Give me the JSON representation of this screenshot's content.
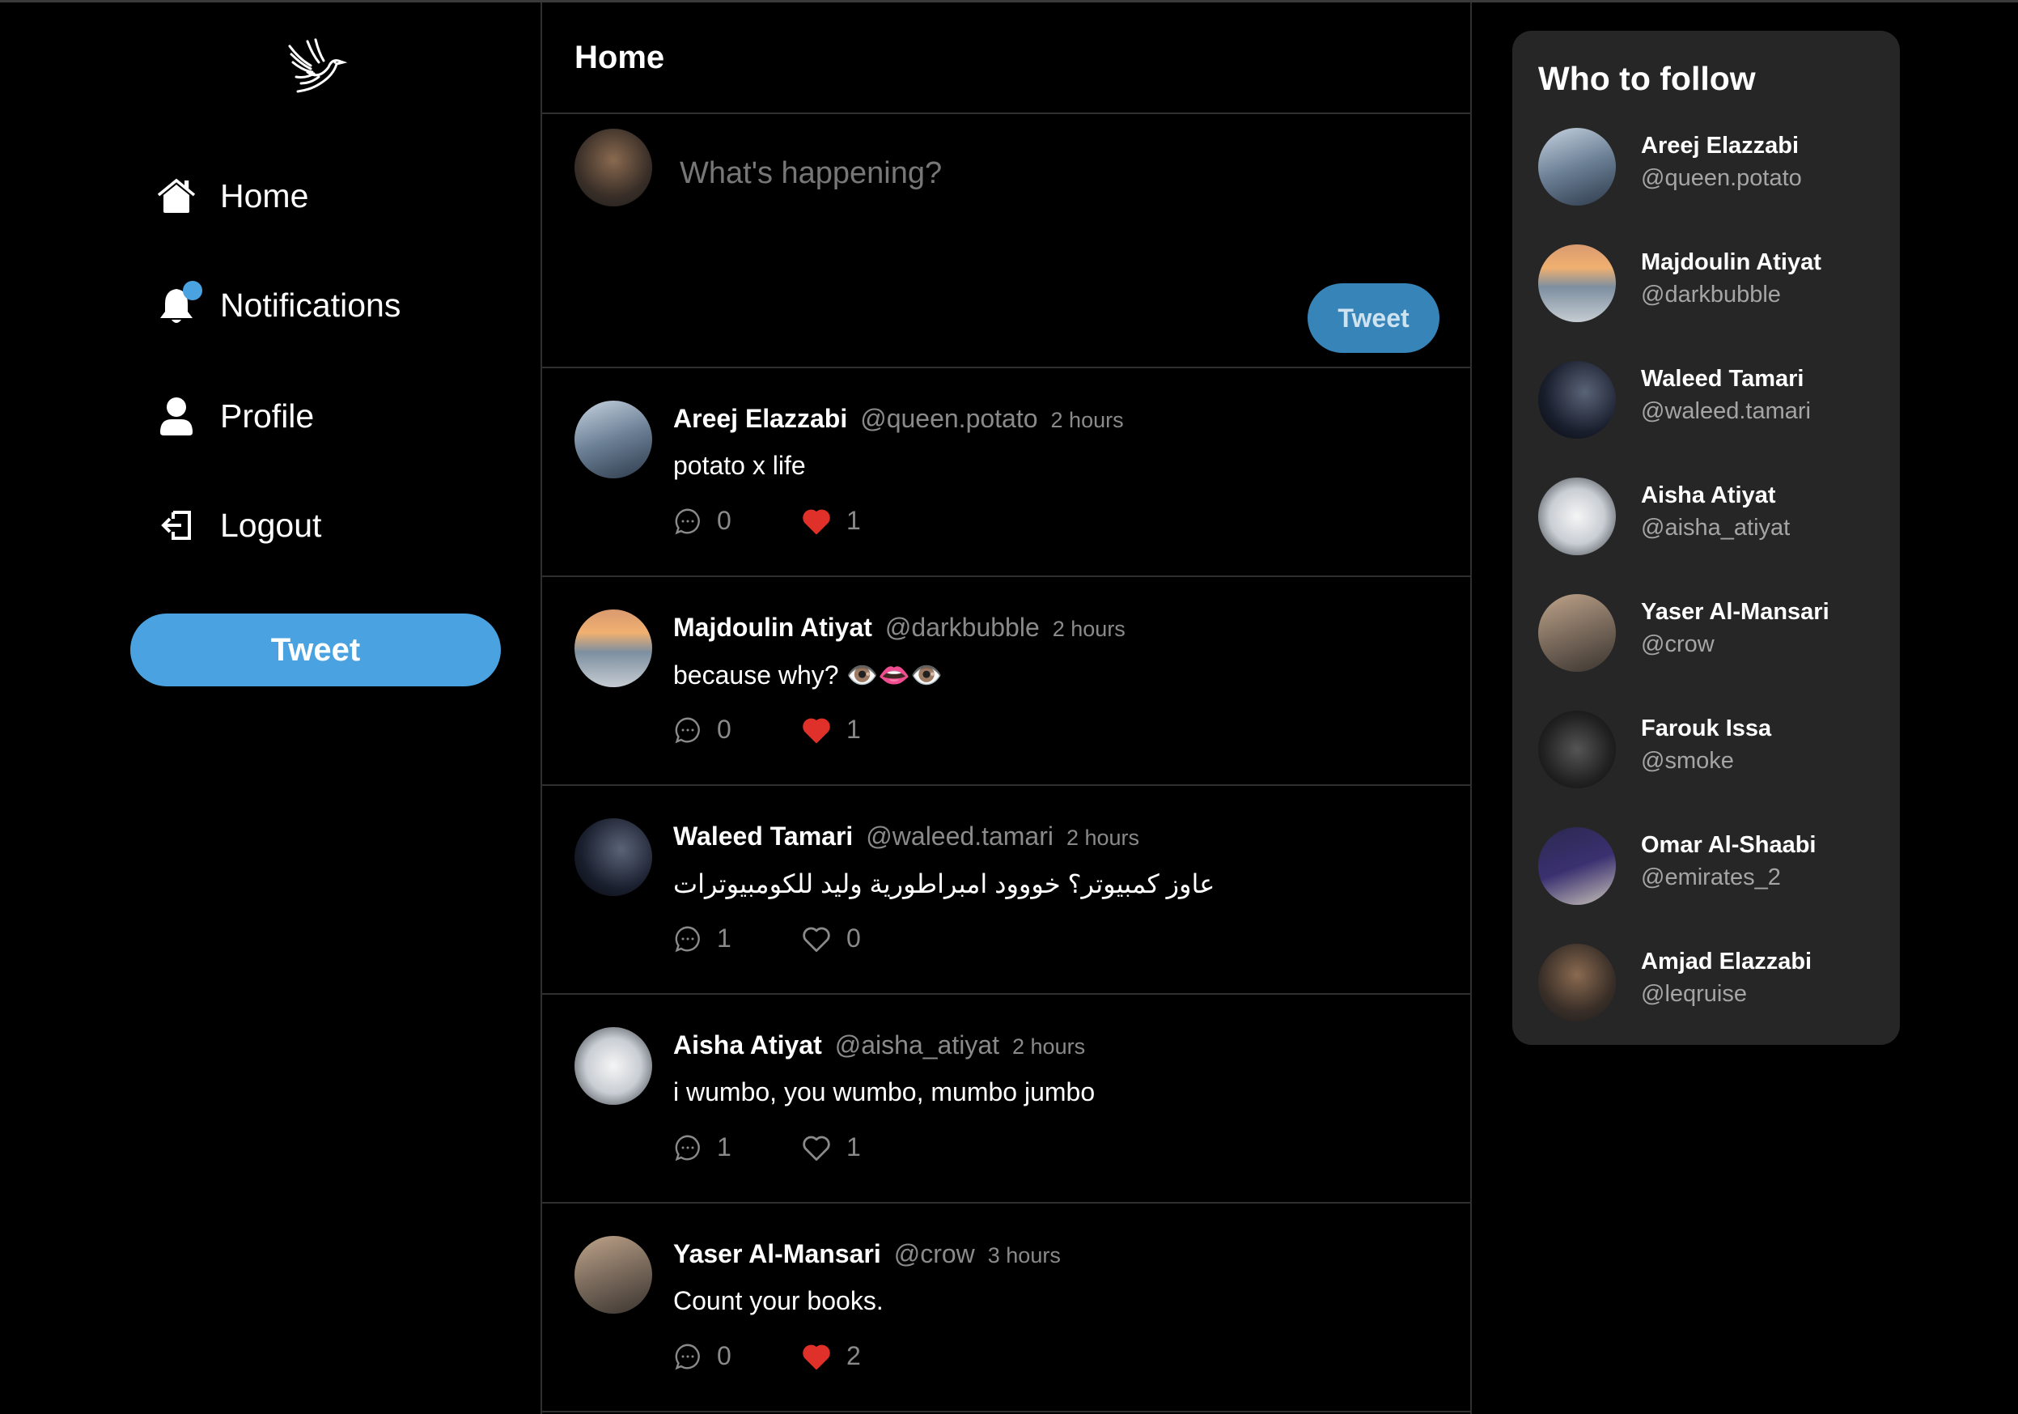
{
  "sidebar": {
    "logo": "bird-logo",
    "nav": [
      {
        "label": "Home",
        "icon": "home-icon"
      },
      {
        "label": "Notifications",
        "icon": "bell-icon"
      },
      {
        "label": "Profile",
        "icon": "user-icon"
      },
      {
        "label": "Logout",
        "icon": "logout-icon"
      }
    ],
    "tweet_label": "Tweet"
  },
  "main": {
    "title": "Home",
    "compose": {
      "placeholder": "What's happening?",
      "button": "Tweet"
    },
    "tweets": [
      {
        "name": "Areej Elazzabi",
        "handle": "@queen.potato",
        "time": "2 hours",
        "text": "potato x life",
        "comments": "0",
        "likes": "1",
        "liked": true
      },
      {
        "name": "Majdoulin Atiyat",
        "handle": "@darkbubble",
        "time": "2 hours",
        "text": "because why? 👁️👄👁️",
        "comments": "0",
        "likes": "1",
        "liked": true
      },
      {
        "name": "Waleed Tamari",
        "handle": "@waleed.tamari",
        "time": "2 hours",
        "text": "عاوز كمبيوتر؟ خووود امبراطورية وليد للكومبيوترات",
        "comments": "1",
        "likes": "0",
        "liked": false
      },
      {
        "name": "Aisha Atiyat",
        "handle": "@aisha_atiyat",
        "time": "2 hours",
        "text": "i wumbo, you wumbo, mumbo jumbo",
        "comments": "1",
        "likes": "1",
        "liked": false
      },
      {
        "name": "Yaser Al-Mansari",
        "handle": "@crow",
        "time": "3 hours",
        "text": "Count your books.",
        "comments": "0",
        "likes": "2",
        "liked": true
      }
    ]
  },
  "who_to_follow": {
    "title": "Who to follow",
    "users": [
      {
        "name": "Areej Elazzabi",
        "handle": "@queen.potato"
      },
      {
        "name": "Majdoulin Atiyat",
        "handle": "@darkbubble"
      },
      {
        "name": "Waleed Tamari",
        "handle": "@waleed.tamari"
      },
      {
        "name": "Aisha Atiyat",
        "handle": "@aisha_atiyat"
      },
      {
        "name": "Yaser Al-Mansari",
        "handle": "@crow"
      },
      {
        "name": "Farouk Issa",
        "handle": "@smoke"
      },
      {
        "name": "Omar Al-Shaabi",
        "handle": "@emirates_2"
      },
      {
        "name": "Amjad Elazzabi",
        "handle": "@leqruise"
      }
    ]
  },
  "colors": {
    "accent": "#4aa3e0",
    "like": "#e0302a",
    "card": "#262626"
  }
}
